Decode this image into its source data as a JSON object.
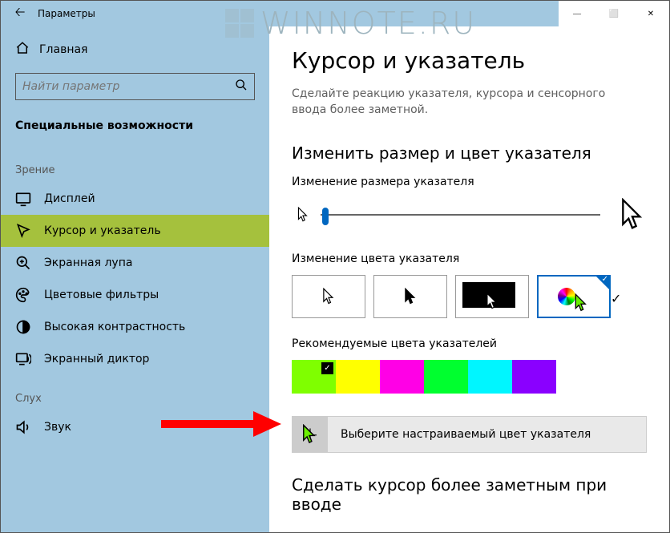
{
  "watermark": "WINNOTE.RU",
  "titlebar": {
    "title": "Параметры"
  },
  "window_buttons": {
    "minimize": "—",
    "maximize": "⬜",
    "close": "✕"
  },
  "sidebar": {
    "home": "Главная",
    "search_placeholder": "Найти параметр",
    "category": "Специальные возможности",
    "groups": [
      {
        "label": "Зрение",
        "items": [
          {
            "id": "display",
            "label": "Дисплей"
          },
          {
            "id": "cursor",
            "label": "Курсор и указатель",
            "selected": true
          },
          {
            "id": "magnifier",
            "label": "Экранная лупа"
          },
          {
            "id": "colorfilt",
            "label": "Цветовые фильтры"
          },
          {
            "id": "contrast",
            "label": "Высокая контрастность"
          },
          {
            "id": "narrator",
            "label": "Экранный диктор"
          }
        ]
      },
      {
        "label": "Слух",
        "items": [
          {
            "id": "audio",
            "label": "Звук"
          }
        ]
      }
    ]
  },
  "main": {
    "title": "Курсор и указатель",
    "description": "Сделайте реакцию указателя, курсора и сенсорного ввода более заметной.",
    "h2_size_color": "Изменить размер и цвет указателя",
    "h3_size": "Изменение размера указателя",
    "h3_color": "Изменение цвета указателя",
    "color_options": [
      "white",
      "black",
      "inverted",
      "custom"
    ],
    "color_selected_index": 3,
    "h3_recommended": "Рекомендуемые цвета указателей",
    "swatches": [
      "#7fff00",
      "#ffff00",
      "#ff00e6",
      "#00ff2f",
      "#00f6ff",
      "#8a00ff"
    ],
    "swatch_selected_index": 0,
    "custom_color_label": "Выберите настраиваемый цвет указателя",
    "h2_cursor": "Сделать курсор более заметным при вводе"
  }
}
